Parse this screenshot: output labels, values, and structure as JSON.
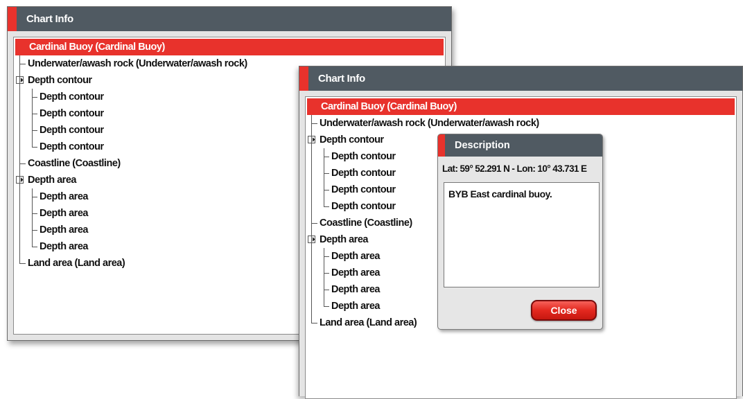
{
  "window_back": {
    "title": "Chart Info",
    "items": [
      {
        "label": "Cardinal Buoy (Cardinal Buoy)",
        "level": 0,
        "selected": true
      },
      {
        "label": "Underwater/awash rock (Underwater/awash rock)",
        "level": 0
      },
      {
        "label": "Depth contour",
        "level": 0,
        "expandable": true
      },
      {
        "label": "Depth contour",
        "level": 1
      },
      {
        "label": "Depth contour",
        "level": 1
      },
      {
        "label": "Depth contour",
        "level": 1
      },
      {
        "label": "Depth contour",
        "level": 1
      },
      {
        "label": "Coastline (Coastline)",
        "level": 0
      },
      {
        "label": "Depth area",
        "level": 0,
        "expandable": true
      },
      {
        "label": "Depth area",
        "level": 1
      },
      {
        "label": "Depth area",
        "level": 1
      },
      {
        "label": "Depth area",
        "level": 1
      },
      {
        "label": "Depth area",
        "level": 1
      },
      {
        "label": "Land area (Land area)",
        "level": 0
      }
    ]
  },
  "window_front": {
    "title": "Chart Info",
    "items": [
      {
        "label": "Cardinal Buoy (Cardinal Buoy)",
        "level": 0,
        "selected": true
      },
      {
        "label": "Underwater/awash rock (Underwater/awash rock)",
        "level": 0
      },
      {
        "label": "Depth contour",
        "level": 0,
        "expandable": true
      },
      {
        "label": "Depth contour",
        "level": 1
      },
      {
        "label": "Depth contour",
        "level": 1
      },
      {
        "label": "Depth contour",
        "level": 1
      },
      {
        "label": "Depth contour",
        "level": 1
      },
      {
        "label": "Coastline (Coastline)",
        "level": 0
      },
      {
        "label": "Depth area",
        "level": 0,
        "expandable": true
      },
      {
        "label": "Depth area",
        "level": 1
      },
      {
        "label": "Depth area",
        "level": 1
      },
      {
        "label": "Depth area",
        "level": 1
      },
      {
        "label": "Depth area",
        "level": 1
      },
      {
        "label": "Land area (Land area)",
        "level": 0
      }
    ]
  },
  "dialog": {
    "title": "Description",
    "coordinates": "Lat: 59° 52.291 N - Lon: 10° 43.731 E",
    "description": "BYB East cardinal buoy.",
    "close_label": "Close"
  },
  "colors": {
    "accent": "#e8322c",
    "titlebar": "#505a62",
    "window_bg": "#e4e4e4"
  }
}
